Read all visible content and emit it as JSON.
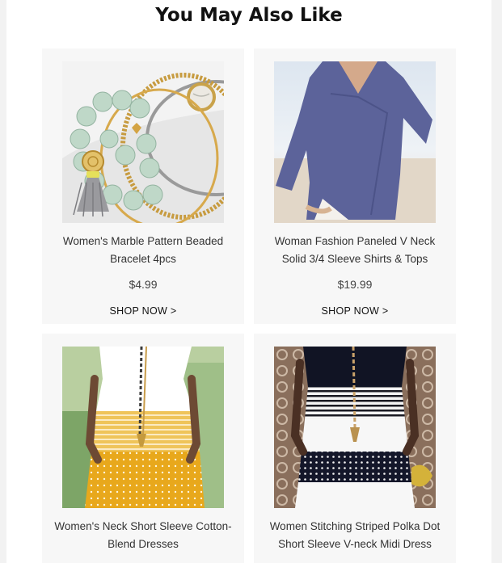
{
  "section_title": "You May Also Like",
  "products": [
    {
      "name": "Women's Marble Pattern Beaded Bracelet 4pcs",
      "price": "$4.99",
      "cta": "SHOP NOW >"
    },
    {
      "name": "Woman Fashion Paneled V Neck Solid 3/4 Sleeve Shirts & Tops",
      "price": "$19.99",
      "cta": "SHOP NOW >"
    },
    {
      "name": "Women's Neck Short Sleeve Cotton-Blend Dresses"
    },
    {
      "name": "Women Stitching Striped Polka Dot Short Sleeve V-neck Midi Dress"
    }
  ]
}
